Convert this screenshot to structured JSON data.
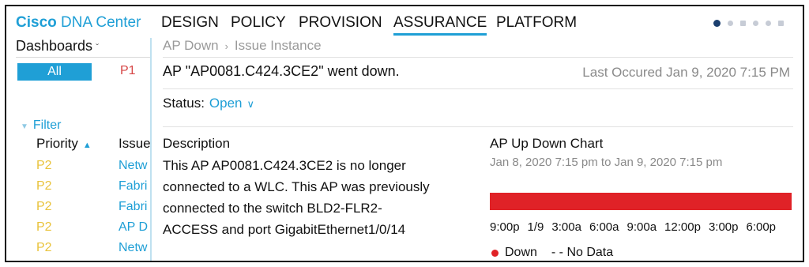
{
  "nav": {
    "brand_bold": "Cisco",
    "brand_rest": " DNA Center",
    "items": [
      "DESIGN",
      "POLICY",
      "PROVISION",
      "ASSURANCE",
      "PLATFORM"
    ],
    "active": "ASSURANCE"
  },
  "sidebar": {
    "dashboards_label": "Dashboards",
    "all_label": "All",
    "p1_label": "P1",
    "filter_label": "Filter",
    "columns": {
      "priority": "Priority",
      "issue": "Issue"
    },
    "rows": [
      {
        "priority": "P2",
        "issue": "Netw"
      },
      {
        "priority": "P2",
        "issue": "Fabri"
      },
      {
        "priority": "P2",
        "issue": "Fabri"
      },
      {
        "priority": "P2",
        "issue": "AP D"
      },
      {
        "priority": "P2",
        "issue": "Netw"
      }
    ]
  },
  "breadcrumb": {
    "items": [
      "AP Down",
      "Issue Instance"
    ]
  },
  "issue": {
    "title": "AP \"AP0081.C424.3CE2\" went down.",
    "last_occurred": "Last Occured Jan 9, 2020 7:15 PM",
    "status_label": "Status:",
    "status_value": "Open"
  },
  "description": {
    "heading": "Description",
    "lines": [
      "This AP AP0081.C424.3CE2 is no longer",
      "connected to a WLC. This AP was previously",
      "connected to the switch BLD2-FLR2-",
      "ACCESS and port GigabitEthernet1/0/14"
    ]
  },
  "chart": {
    "heading": "AP Up Down Chart",
    "range": "Jan 8, 2020 7:15 pm to Jan 9, 2020 7:15 pm",
    "ticks": [
      "9:00p",
      "1/9",
      "3:00a",
      "6:00a",
      "9:00a",
      "12:00p",
      "3:00p",
      "6:00p"
    ],
    "legend": {
      "down": "Down",
      "nodata": "- - No Data"
    },
    "down_color": "#e02227"
  },
  "colors": {
    "accent": "#1f9fd6",
    "p1": "#d64545",
    "p2": "#e9c33b"
  }
}
